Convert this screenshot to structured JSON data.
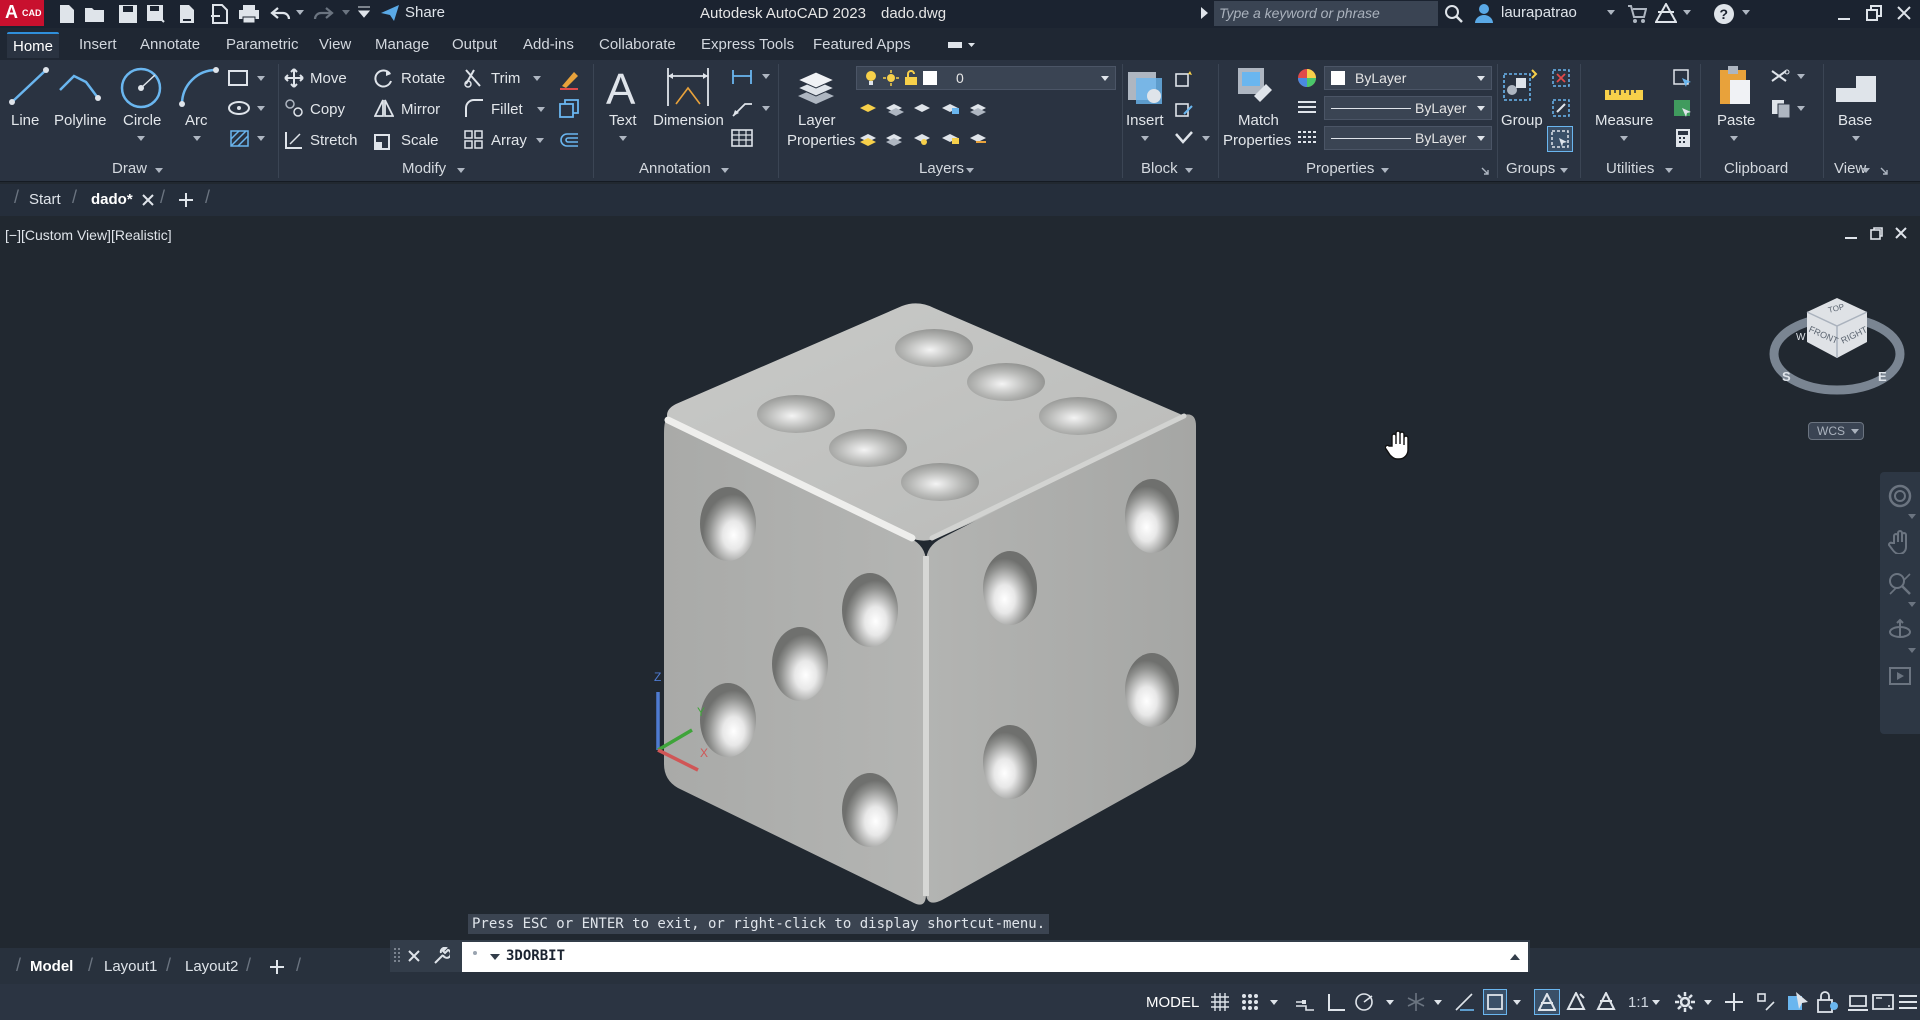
{
  "app": {
    "logo_text": "CAD",
    "title": "Autodesk AutoCAD 2023",
    "filename": "dado.dwg",
    "share_label": "Share",
    "search_placeholder": "Type a keyword or phrase",
    "username": "laurapatrao"
  },
  "ribbon_tabs": [
    "Home",
    "Insert",
    "Annotate",
    "Parametric",
    "View",
    "Manage",
    "Output",
    "Add-ins",
    "Collaborate",
    "Express Tools",
    "Featured Apps"
  ],
  "ribbon": {
    "draw": {
      "title": "Draw",
      "line": "Line",
      "polyline": "Polyline",
      "circle": "Circle",
      "arc": "Arc"
    },
    "modify": {
      "title": "Modify",
      "move": "Move",
      "rotate": "Rotate",
      "trim": "Trim",
      "copy": "Copy",
      "mirror": "Mirror",
      "fillet": "Fillet",
      "stretch": "Stretch",
      "scale": "Scale",
      "array": "Array"
    },
    "annotation": {
      "title": "Annotation",
      "text": "Text",
      "dimension": "Dimension"
    },
    "layers": {
      "title": "Layers",
      "layer_properties_1": "Layer",
      "layer_properties_2": "Properties",
      "current_layer": "0"
    },
    "block": {
      "title": "Block",
      "insert": "Insert"
    },
    "properties": {
      "title": "Properties",
      "match_1": "Match",
      "match_2": "Properties",
      "color": "ByLayer",
      "linetype": "ByLayer",
      "lineweight": "ByLayer"
    },
    "groups": {
      "title": "Groups",
      "group": "Group"
    },
    "utilities": {
      "title": "Utilities",
      "measure": "Measure"
    },
    "clipboard": {
      "title": "Clipboard",
      "paste": "Paste"
    },
    "view": {
      "title": "View",
      "base": "Base"
    }
  },
  "doc_tabs": {
    "start": "Start",
    "current": "dado*"
  },
  "viewport": {
    "label": "[−][Custom View][Realistic]",
    "wcs": "WCS",
    "viewcube_top": "TOP",
    "viewcube_front": "FRONT",
    "viewcube_right": "RIGHT",
    "compass_s": "S",
    "compass_e": "E",
    "compass_w": "W",
    "axis_z": "Z",
    "axis_y": "Y",
    "axis_x": "X"
  },
  "command": {
    "prompt": "Press ESC or ENTER to exit, or right-click to display shortcut-menu.",
    "current": "3DORBIT"
  },
  "layout_tabs": [
    "Model",
    "Layout1",
    "Layout2"
  ],
  "status": {
    "model": "MODEL",
    "scale": "1:1"
  },
  "colors": {
    "accent": "#2f8fdb",
    "logo_red": "#c8102e",
    "viewport_bg": "#212830"
  }
}
